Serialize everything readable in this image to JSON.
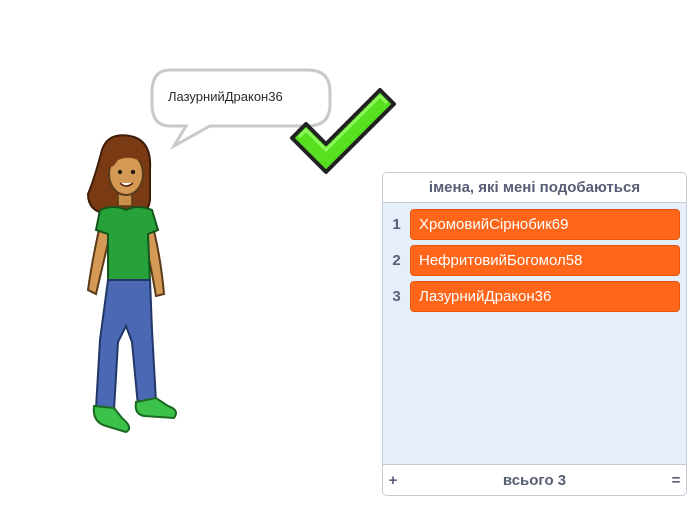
{
  "speech_bubble": {
    "text": "ЛазурнийДракон36"
  },
  "list_monitor": {
    "title": "імена, які мені подобаються",
    "items": [
      {
        "index": "1",
        "value": "ХромовийСірнобик69"
      },
      {
        "index": "2",
        "value": "НефритовийБогомол58"
      },
      {
        "index": "3",
        "value": "ЛазурнийДракон36"
      }
    ],
    "add_label": "+",
    "length_label": "всього 3",
    "resize_label": "="
  },
  "colors": {
    "item_fill": "#ff661a",
    "monitor_bg": "#e6eef9",
    "text_gray": "#575e75",
    "check_green": "#56e01f"
  },
  "icons": [
    "checkmark-icon"
  ]
}
